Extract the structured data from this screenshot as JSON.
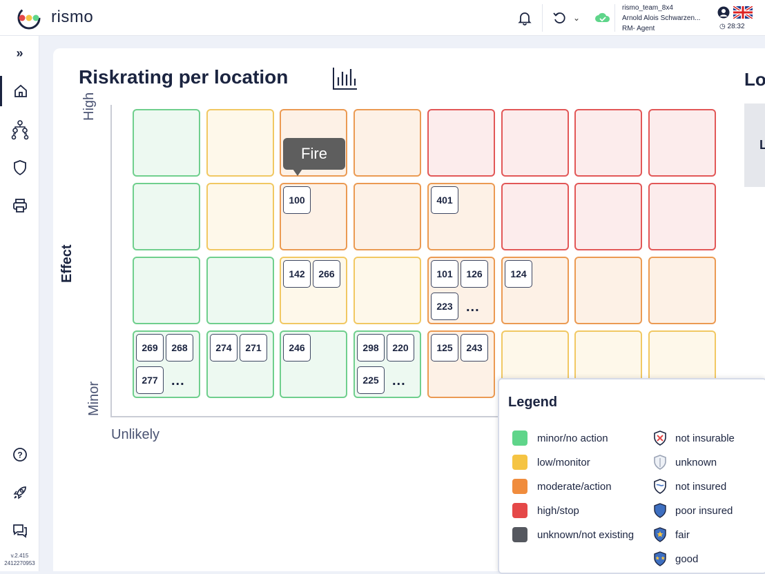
{
  "app": {
    "brand": "rismo"
  },
  "user": {
    "team": "rismo_team_8x4",
    "name": "Arnold Alois Schwarzen...",
    "role": "RM- Agent",
    "time": "28:32"
  },
  "sidebar": {
    "version_line1": "v.2.415",
    "version_line2": "2412270953"
  },
  "page": {
    "title": "Riskrating per location",
    "right_title": "Lo",
    "right_letter": "L"
  },
  "matrix": {
    "y_label": "Effect",
    "y_high": "High",
    "y_low": "Minor",
    "x_low": "Unlikely",
    "tooltip": "Fire",
    "rows": [
      [
        "g",
        "y",
        "o",
        "o",
        "r",
        "r",
        "r",
        "r"
      ],
      [
        "g",
        "y",
        "o",
        "o",
        "o",
        "r",
        "r",
        "r"
      ],
      [
        "g",
        "g",
        "y",
        "y",
        "o",
        "o",
        "o",
        "o"
      ],
      [
        "g",
        "g",
        "g",
        "g",
        "o",
        "y",
        "y",
        "y"
      ]
    ],
    "badges": {
      "r1c2": [
        "100"
      ],
      "r1c4": [
        "401"
      ],
      "r2c2": [
        "142",
        "266"
      ],
      "r2c4": [
        "101",
        "126",
        "223"
      ],
      "r2c5": [
        "124"
      ],
      "r3c0": [
        "269",
        "268",
        "277"
      ],
      "r3c1": [
        "274",
        "271"
      ],
      "r3c2": [
        "246"
      ],
      "r3c3": [
        "298",
        "220",
        "225"
      ],
      "r3c4": [
        "125",
        "243"
      ]
    },
    "more": "..."
  },
  "legend": {
    "title": "Legend",
    "colors": [
      {
        "label": "minor/no action",
        "color": "#5fd58a"
      },
      {
        "label": "low/monitor",
        "color": "#f5c443"
      },
      {
        "label": "moderate/action",
        "color": "#f08c3d"
      },
      {
        "label": "high/stop",
        "color": "#e54848"
      },
      {
        "label": "unknown/not existing",
        "color": "#55585f"
      }
    ],
    "insurance": [
      {
        "label": "not insurable",
        "icon": "shield-x-icon"
      },
      {
        "label": "unknown",
        "icon": "shield-question-icon"
      },
      {
        "label": "not insured",
        "icon": "shield-empty-icon"
      },
      {
        "label": "poor insured",
        "icon": "shield-poor-icon"
      },
      {
        "label": "fair",
        "icon": "shield-fair-icon"
      },
      {
        "label": "good",
        "icon": "shield-good-icon"
      }
    ]
  }
}
